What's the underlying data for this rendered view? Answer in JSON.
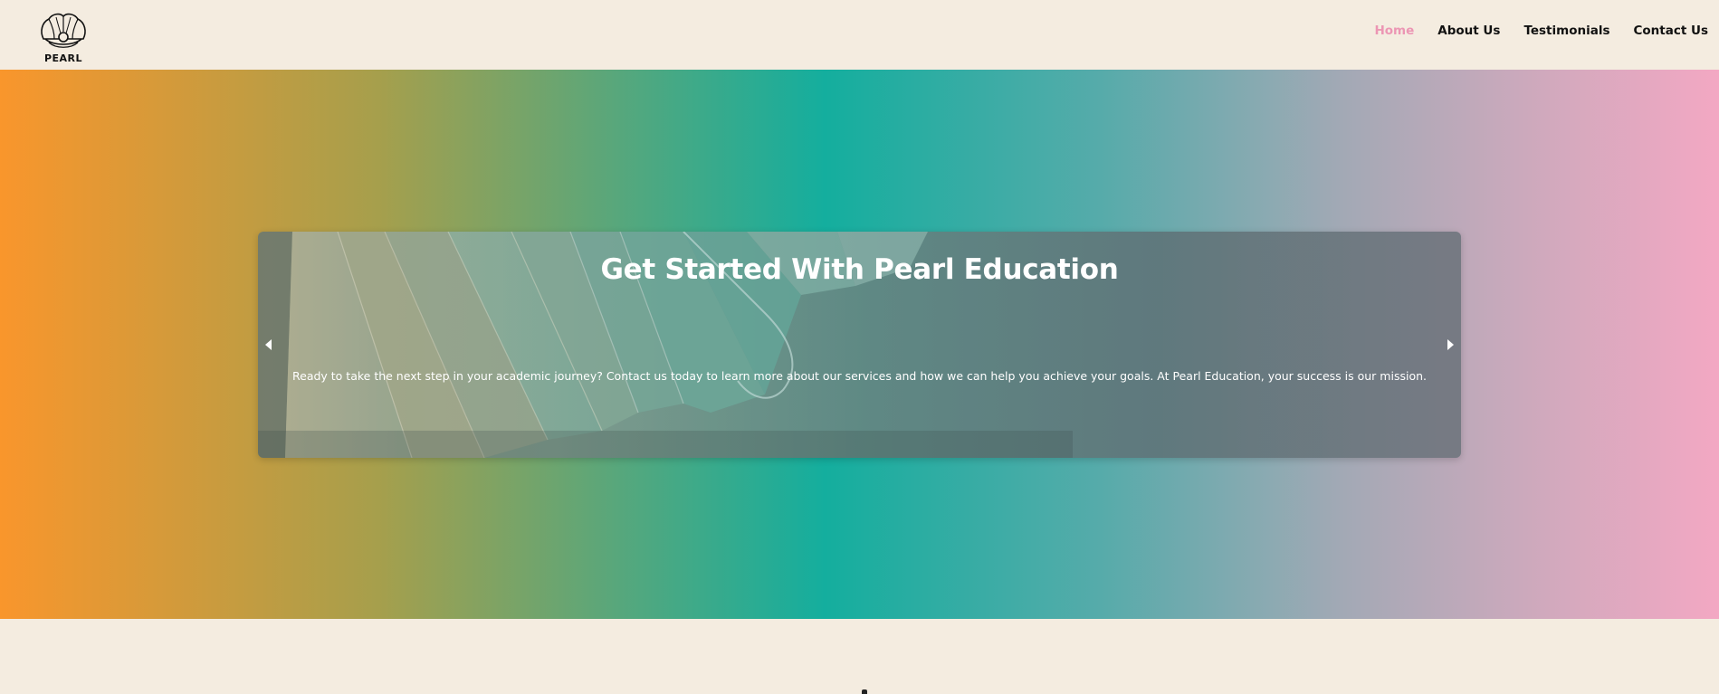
{
  "header": {
    "logo_text": "PEARL",
    "nav": [
      {
        "label": "Home",
        "active": true
      },
      {
        "label": "About Us",
        "active": false
      },
      {
        "label": "Testimonials",
        "active": false
      },
      {
        "label": "Contact Us",
        "active": false
      }
    ],
    "active_color": "#ec96b4"
  },
  "hero": {
    "gradient_colors": [
      "#f9962c",
      "#14ae9e",
      "#f3a8c3"
    ],
    "carousel": {
      "title": "Get Started With Pearl Education",
      "text": "Ready to take the next step in your academic journey? Contact us today to learn more about our services and how we can help you achieve your goals. At Pearl Education, your success is our mission.",
      "prev_icon": "caret-left-icon",
      "next_icon": "caret-right-icon"
    }
  },
  "theme": {
    "background": "#f4ece0"
  }
}
